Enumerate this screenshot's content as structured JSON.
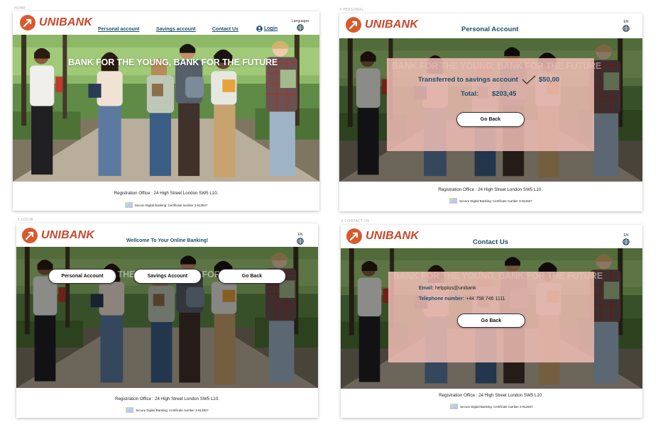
{
  "brand": {
    "name": "UNIBANK"
  },
  "colors": {
    "brand": "#d9592d",
    "nav": "#1d4f6b",
    "modal": "#f0beb4"
  },
  "artboards": {
    "home": "HOME",
    "personal": "3 PERSONAL",
    "login": "3 LOGIN",
    "contact": "3 CONTACT US"
  },
  "home": {
    "nav": {
      "personal": "Personal account",
      "savings": "Savings account",
      "contact": "Contact Us",
      "login": "Login"
    },
    "languages_label": "Languages",
    "headline": "BANK FOR THE YOUNG, BANK FOR THE FUTURE"
  },
  "personal": {
    "title": "Personal Account",
    "lang": "EN",
    "transfer_label": "Transferred to savings account",
    "transfer_amount": "$50,00",
    "total_label": "Total:",
    "total_amount": "$203,45",
    "go_back": "Go Back"
  },
  "login": {
    "title": "Wellcome To Your Online Banking!",
    "lang": "EN",
    "buttons": {
      "personal": "Personal Account",
      "savings": "Savings Account",
      "back": "Go Back"
    }
  },
  "contact": {
    "title": "Contact Us",
    "lang": "EN",
    "email_label": "Email:",
    "email_value": "helpplus@unibank",
    "phone_label": "Telephone number:",
    "phone_value": "+44 758 746 1111",
    "go_back": "Go Back"
  },
  "footer": {
    "address": "Registration Office : 24 High Street London SW5 L10.",
    "address_alt": "Registration Office : 24 High Street London SW5 L10 .",
    "certificate": "Secure Digital Banking: Certificate number 3-912847"
  }
}
